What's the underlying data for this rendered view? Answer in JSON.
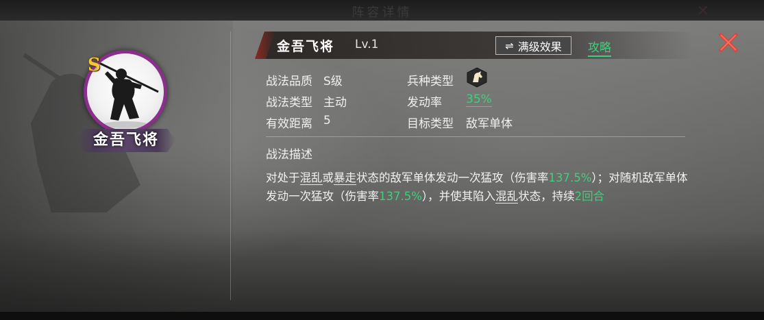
{
  "background": {
    "faded_title": "阵容详情"
  },
  "portrait": {
    "rank": "S",
    "name": "金吾飞将",
    "ring_color": "#8a2f8c",
    "rank_color": "#f4c53a"
  },
  "header": {
    "skill_name": "金吾飞将",
    "level": "Lv.1",
    "max_effect_button": {
      "icon": "swap-arrows-icon",
      "label": "满级效果"
    },
    "guide_link": "攻略",
    "close_icon": "close-icon",
    "link_color": "#3ed07c",
    "close_color": "#e05040"
  },
  "attributes": {
    "quality": {
      "label": "战法品质",
      "value": "S级"
    },
    "skill_type": {
      "label": "战法类型",
      "value": "主动"
    },
    "range": {
      "label": "有效距离",
      "value": "5"
    },
    "unit_type": {
      "label": "兵种类型",
      "icon": "cavalry-horse-icon"
    },
    "trigger_rate": {
      "label": "发动率",
      "value": "35%"
    },
    "target_type": {
      "label": "目标类型",
      "value": "敌军单体"
    }
  },
  "description": {
    "heading": "战法描述",
    "segments": [
      {
        "text": "对处于",
        "style": "plain"
      },
      {
        "text": "混乱",
        "style": "underline"
      },
      {
        "text": "或",
        "style": "plain"
      },
      {
        "text": "暴走",
        "style": "underline"
      },
      {
        "text": "状态的敌军单体发动一次猛攻（伤害率",
        "style": "plain"
      },
      {
        "text": "137.5%",
        "style": "highlight"
      },
      {
        "text": "）；对随机敌军单体发动一次猛攻（伤害率",
        "style": "plain"
      },
      {
        "text": "137.5%",
        "style": "highlight"
      },
      {
        "text": "），并使其陷入",
        "style": "plain"
      },
      {
        "text": "混乱",
        "style": "underline"
      },
      {
        "text": "状态，持续",
        "style": "plain"
      },
      {
        "text": "2回合",
        "style": "highlight"
      }
    ]
  }
}
